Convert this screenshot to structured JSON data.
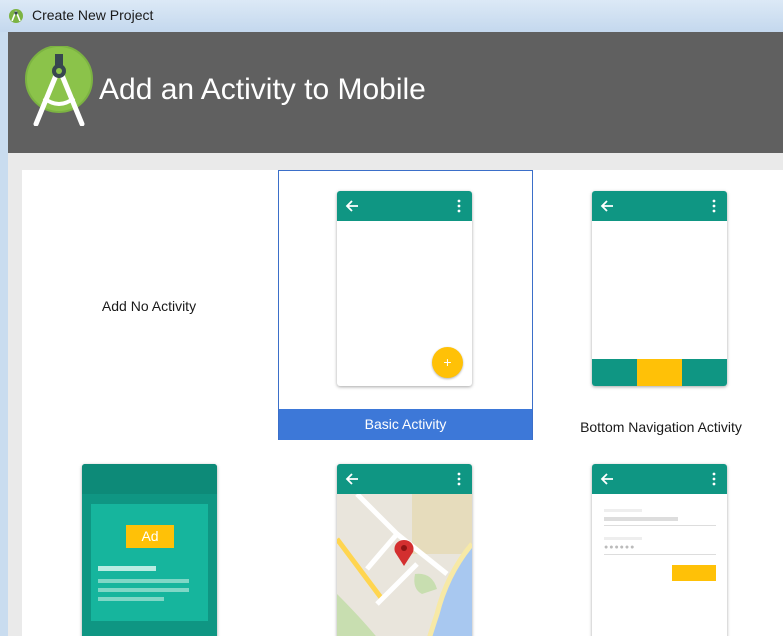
{
  "window": {
    "title": "Create New Project"
  },
  "header": {
    "title": "Add an Activity to Mobile",
    "logo_icon": "android-studio-logo"
  },
  "activities": [
    {
      "label": "Add No Activity",
      "selected": false
    },
    {
      "label": "Basic Activity",
      "selected": true
    },
    {
      "label": "Bottom Navigation Activity",
      "selected": false
    },
    {
      "label": "",
      "selected": false,
      "preview": "ad-banner",
      "badge": "Ad"
    },
    {
      "label": "",
      "selected": false,
      "preview": "map"
    },
    {
      "label": "",
      "selected": false,
      "preview": "login-form"
    }
  ],
  "colors": {
    "header_bg": "#606060",
    "teal": "#0f9683",
    "amber": "#ffc107",
    "selection": "#3d78d8"
  }
}
